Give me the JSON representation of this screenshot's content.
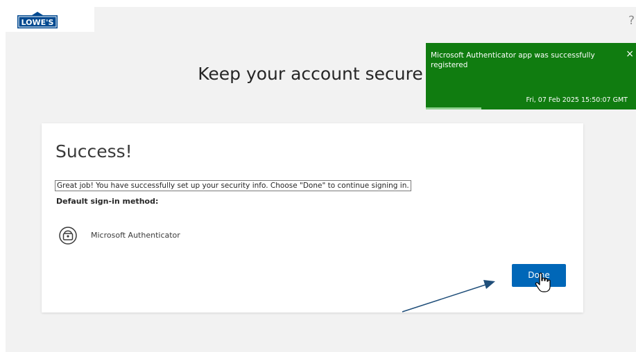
{
  "header": {
    "logo_text": "LOWE'S",
    "help_label": "?"
  },
  "page": {
    "title": "Keep your account secure"
  },
  "toast": {
    "message": "Microsoft Authenticator app was successfully registered",
    "close_label": "×",
    "timestamp": "Fri, 07 Feb 2025 15:50:07 GMT"
  },
  "card": {
    "heading": "Success!",
    "message": "Great job! You have successfully set up your security info. Choose \"Done\" to continue signing in.",
    "default_label": "Default sign-in method:",
    "method_label": "Microsoft Authenticator",
    "done_label": "Done"
  },
  "icons": {
    "logo": "lowes-logo",
    "help": "help-icon",
    "method": "authenticator-lock-icon",
    "close": "close-icon",
    "cursor": "hand-pointer-icon",
    "annotation": "annotation-arrow"
  },
  "colors": {
    "toast_bg": "#107c10",
    "primary_button": "#0067b8",
    "logo_blue": "#004990"
  }
}
